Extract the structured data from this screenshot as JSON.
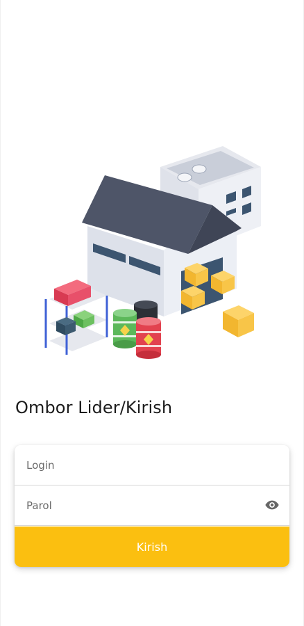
{
  "page": {
    "title": "Ombor Lider/Kirish"
  },
  "form": {
    "login_placeholder": "Login",
    "password_placeholder": "Parol",
    "submit_label": "Kirish",
    "toggle_icon": "eye-icon"
  },
  "illustration": {
    "subject": "warehouse-illustration"
  },
  "colors": {
    "accent": "#FBBF10",
    "title_text": "#1B1B1B",
    "placeholder_text": "#6A6A6A"
  }
}
